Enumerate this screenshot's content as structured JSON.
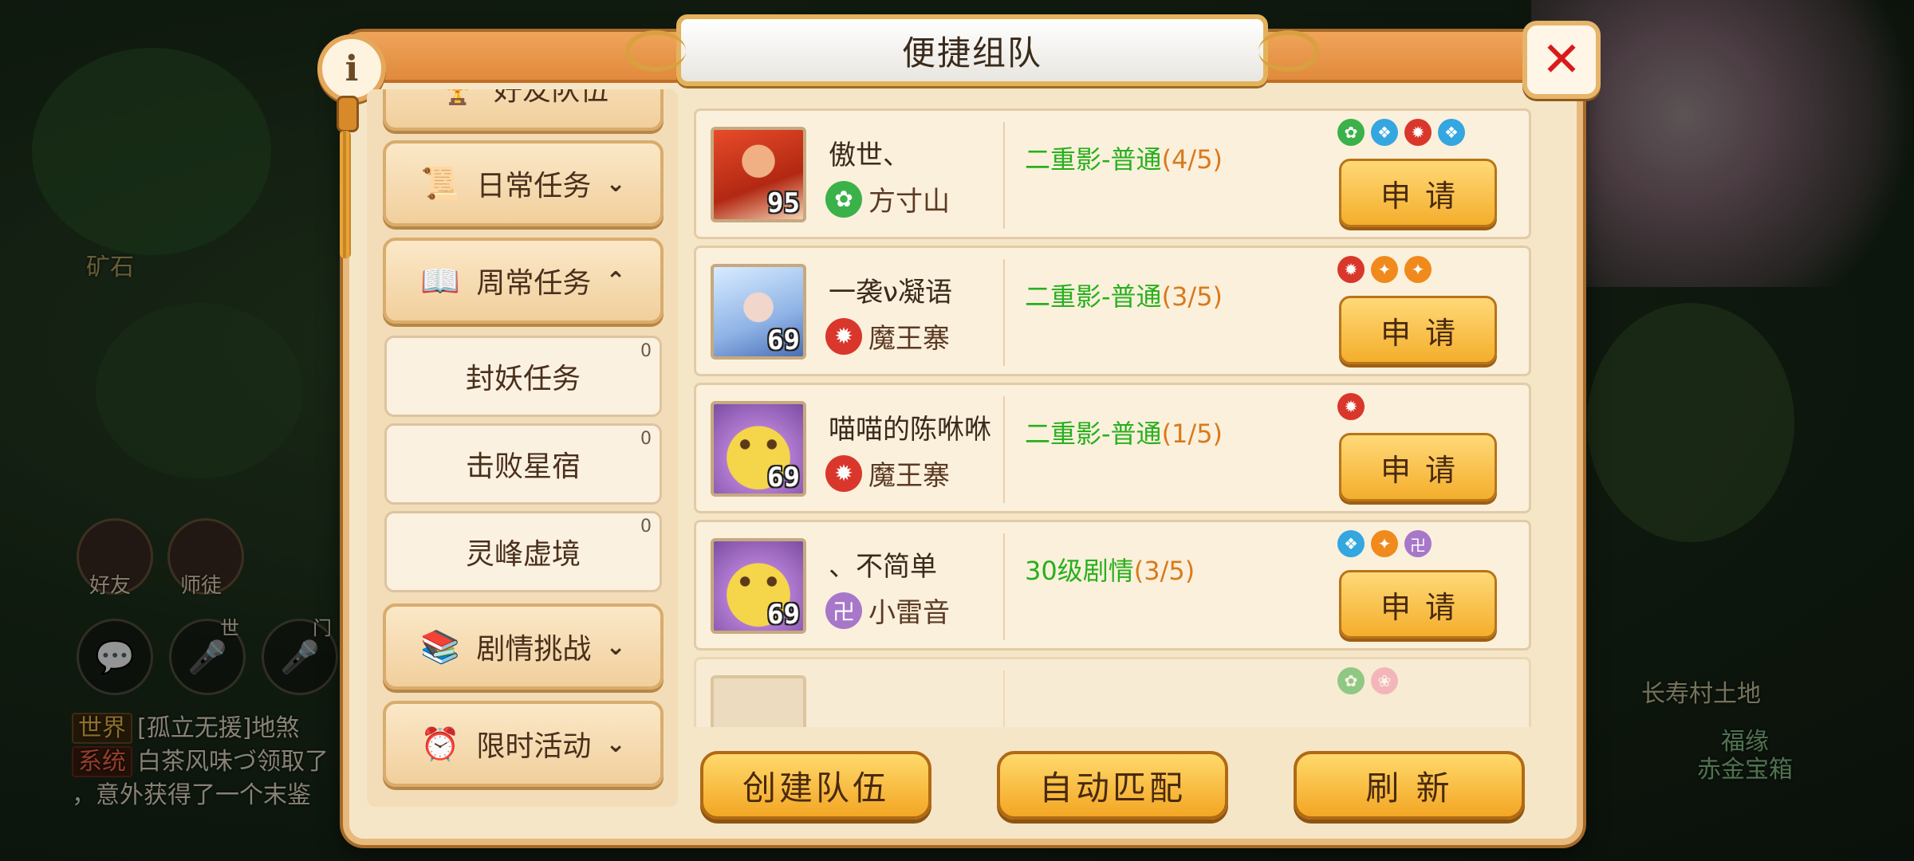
{
  "scene": {
    "labels": [
      "矿石",
      "长寿村土地",
      "福缘",
      "赤金宝箱"
    ],
    "hud": {
      "friends_label": "好友",
      "mentor_label": "师徒",
      "channel_world": "世",
      "channel_team": "门"
    },
    "chat": [
      {
        "tag": "世界",
        "tag_type": "world",
        "text": "[孤立无援]地煞"
      },
      {
        "tag": "系统",
        "tag_type": "sys",
        "text": "白茶风味づ领取了"
      },
      {
        "tag": "",
        "tag_type": "",
        "text": "，意外获得了一个末鉴"
      }
    ]
  },
  "dialog": {
    "title": "便捷组队",
    "info_label": "i",
    "close_label": "✕"
  },
  "sidebar": {
    "partial_top": {
      "label": "好友队伍",
      "icon": "trophy-icon",
      "glyph": "🏆"
    },
    "items": [
      {
        "label": "日常任务",
        "icon": "scroll-icon",
        "glyph": "📜",
        "expanded": false
      },
      {
        "label": "周常任务",
        "icon": "book-icon",
        "glyph": "📖",
        "expanded": true
      }
    ],
    "subitems": [
      {
        "label": "封妖任务",
        "count": "0"
      },
      {
        "label": "击败星宿",
        "count": "0"
      },
      {
        "label": "灵峰虚境",
        "count": "0"
      }
    ],
    "items_after": [
      {
        "label": "剧情挑战",
        "icon": "scrolls-icon",
        "glyph": "📚",
        "expanded": false
      },
      {
        "label": "限时活动",
        "icon": "alarm-clock-icon",
        "glyph": "⏰",
        "expanded": false
      }
    ]
  },
  "teams": [
    {
      "name": "傲世、",
      "level": "95",
      "avatar": "red",
      "sect": "方寸山",
      "sect_color": "#3bb14a",
      "sect_glyph": "✿",
      "activity": "二重影-普通",
      "count": "4/5",
      "members": [
        "green",
        "blue",
        "red",
        "blue"
      ],
      "apply": "申请"
    },
    {
      "name": "一袭ν凝语",
      "level": "69",
      "avatar": "blue",
      "sect": "魔王寨",
      "sect_color": "#d9372b",
      "sect_glyph": "✹",
      "activity": "二重影-普通",
      "count": "3/5",
      "members": [
        "red",
        "orange",
        "orange"
      ],
      "apply": "申请"
    },
    {
      "name": "喵喵的陈咻咻",
      "level": "69",
      "avatar": "cat",
      "sect": "魔王寨",
      "sect_color": "#d9372b",
      "sect_glyph": "✹",
      "activity": "二重影-普通",
      "count": "1/5",
      "members": [
        "red"
      ],
      "apply": "申请"
    },
    {
      "name": "、不简单",
      "level": "69",
      "avatar": "cat",
      "sect": "小雷音",
      "sect_color": "#a777c9",
      "sect_glyph": "卍",
      "activity": "30级剧情",
      "count": "3/5",
      "members": [
        "blue",
        "orange",
        "purple"
      ],
      "apply": "申请"
    },
    {
      "name": "",
      "level": "",
      "avatar": "dim",
      "sect": "",
      "sect_color": "#cfc4b2",
      "sect_glyph": "",
      "activity": "",
      "count": "",
      "members": [
        "green",
        "pink"
      ],
      "apply": ""
    }
  ],
  "bottom": {
    "create": "创建队伍",
    "auto_match": "自动匹配",
    "refresh": "刷 新"
  }
}
